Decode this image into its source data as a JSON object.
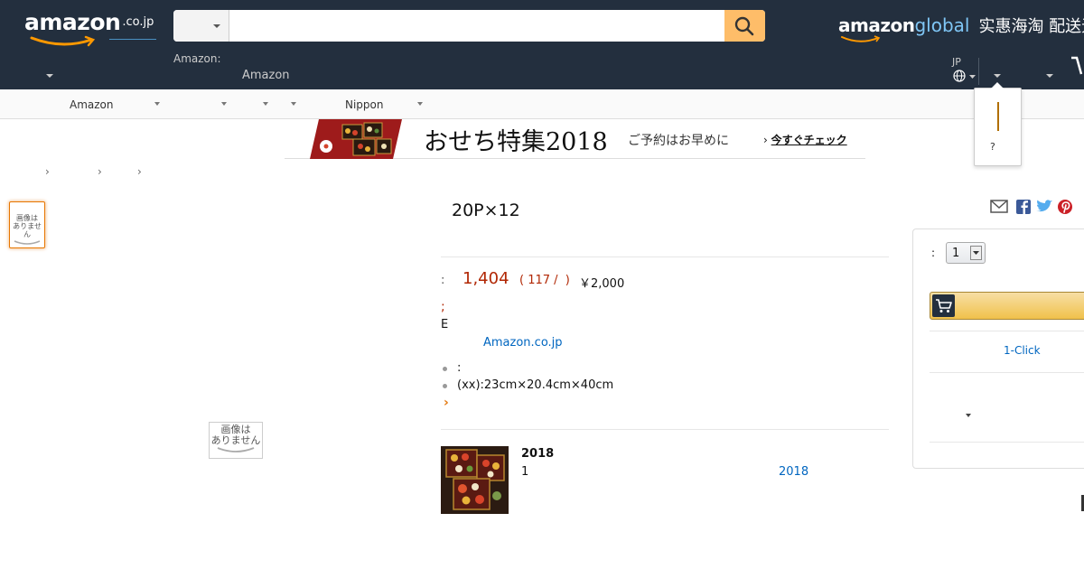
{
  "header": {
    "logo_word": "amazon",
    "logo_tld": ".co.jp",
    "search": {
      "category_value": "",
      "placeholder": ""
    },
    "deliver_label": "Amazon:",
    "amazon_link": "Amazon",
    "global_word": "amazon",
    "global_suffix": "global",
    "global_cn": "实惠海淘 配送无",
    "lang": "JP"
  },
  "subnav": {
    "items": [
      {
        "label": "Amazon"
      },
      {
        "label": ""
      },
      {
        "label": ""
      },
      {
        "label": ""
      },
      {
        "label": "Nippon"
      }
    ]
  },
  "popover": {
    "text": "?"
  },
  "banner": {
    "title": "おせち特集2018",
    "subtitle": "ご予約はお早めに",
    "cta_arrow": "›",
    "cta": "今すぐチェック"
  },
  "breadcrumb": [
    "›",
    "›",
    "›"
  ],
  "images": {
    "no_image_line1": "画像は",
    "no_image_line2": "ありません"
  },
  "product": {
    "title": "20P×12",
    "price_label": ":",
    "price": "1,404",
    "unit_price": "( 117 /  )",
    "list_price": "￥2,000",
    "semicolon": ";",
    "e_char": "E",
    "shipped_by": "Amazon.co.jp",
    "bullets": [
      ":",
      "(xx):23cm×20.4cm×40cm"
    ],
    "more": "›"
  },
  "promo": {
    "title": "2018",
    "num": "1",
    "link": "2018"
  },
  "buybox": {
    "qty_label": ":",
    "qty_value": "1",
    "oneclick": "1-Click"
  },
  "colors": {
    "nav_bg": "#232f3e",
    "search_button": "#febd69",
    "price": "#b12704",
    "link": "#0066c0",
    "accent_orange": "#e47911"
  }
}
